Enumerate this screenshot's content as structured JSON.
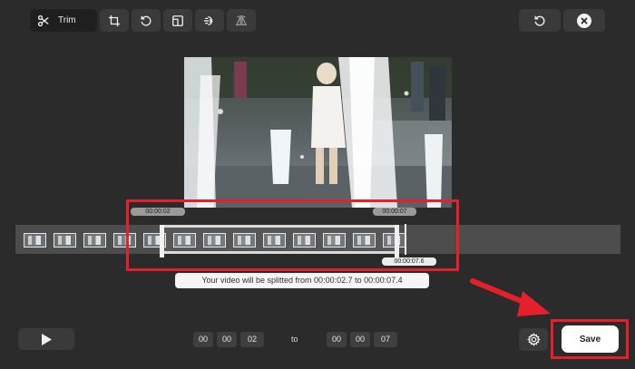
{
  "toolbar": {
    "trim_label": "Trim",
    "tools": [
      {
        "name": "crop-icon"
      },
      {
        "name": "rotate-icon"
      },
      {
        "name": "aspect-ratio-icon"
      },
      {
        "name": "speed-icon"
      },
      {
        "name": "flip-icon"
      }
    ]
  },
  "window_controls": {
    "reset_icon": "reset-icon",
    "close_icon": "close-icon"
  },
  "timeline": {
    "start_tag": "00:00:02",
    "end_tag": "00:00:07",
    "playhead_tag": "00:00:07.6",
    "thumbnail_count": 13
  },
  "info": {
    "message": "Your video will be splitted from 00:00:02.7 to 00:00:07.4"
  },
  "range": {
    "start": {
      "h": "00",
      "m": "00",
      "s": "02"
    },
    "to_label": "to",
    "end": {
      "h": "00",
      "m": "00",
      "s": "07"
    }
  },
  "actions": {
    "save_label": "Save"
  },
  "colors": {
    "highlight": "#e3202b",
    "background": "#2b2b2b"
  }
}
